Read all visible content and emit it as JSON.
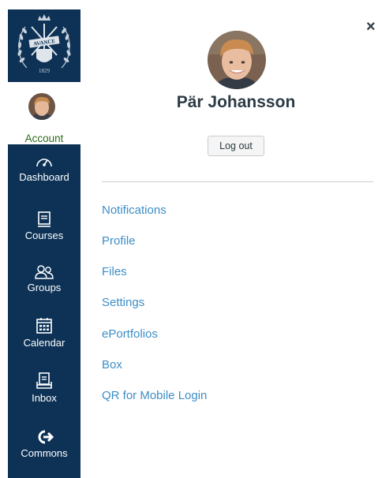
{
  "sidebar": {
    "logo": {
      "seal_text": "AVANCE",
      "seal_year": "1829",
      "icon": "kth-seal-logo"
    },
    "account": {
      "label": "Account",
      "icon": "user-avatar"
    },
    "nav": [
      {
        "key": "dashboard",
        "label": "Dashboard",
        "icon": "dashboard-gauge-icon"
      },
      {
        "key": "courses",
        "label": "Courses",
        "icon": "courses-book-icon"
      },
      {
        "key": "groups",
        "label": "Groups",
        "icon": "groups-people-icon"
      },
      {
        "key": "calendar",
        "label": "Calendar",
        "icon": "calendar-icon"
      },
      {
        "key": "inbox",
        "label": "Inbox",
        "icon": "inbox-tray-icon"
      },
      {
        "key": "commons",
        "label": "Commons",
        "icon": "commons-arrow-icon"
      }
    ]
  },
  "tray": {
    "close_symbol": "×",
    "user_name": "Pär Johansson",
    "logout_label": "Log out",
    "links": [
      "Notifications",
      "Profile",
      "Files",
      "Settings",
      "ePortfolios",
      "Box",
      "QR for Mobile Login"
    ]
  },
  "colors": {
    "nav_bg": "#0d3256",
    "account_text": "#2d6e1a",
    "link": "#3d8ec6",
    "name_text": "#2d3b45"
  }
}
